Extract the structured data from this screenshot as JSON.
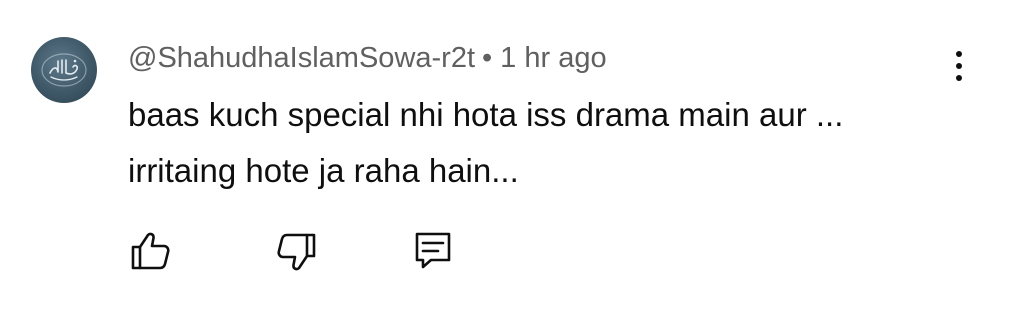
{
  "comment": {
    "author": "@ShahudhaIslamSowa-r2t",
    "separator": "•",
    "timestamp": "1 hr ago",
    "text_lines": [
      "baas kuch special nhi hota iss drama main aur ...",
      "irritaing hote ja raha hain..."
    ]
  },
  "icons": {
    "avatar": "avatar-calligraphy-icon",
    "menu": "more-vert-icon",
    "like": "thumb-up-icon",
    "dislike": "thumb-down-icon",
    "reply": "comment-reply-icon"
  },
  "colors": {
    "text": "#0f0f0f",
    "meta": "#606060",
    "avatar_bg": "#3f5868",
    "background": "#ffffff"
  }
}
